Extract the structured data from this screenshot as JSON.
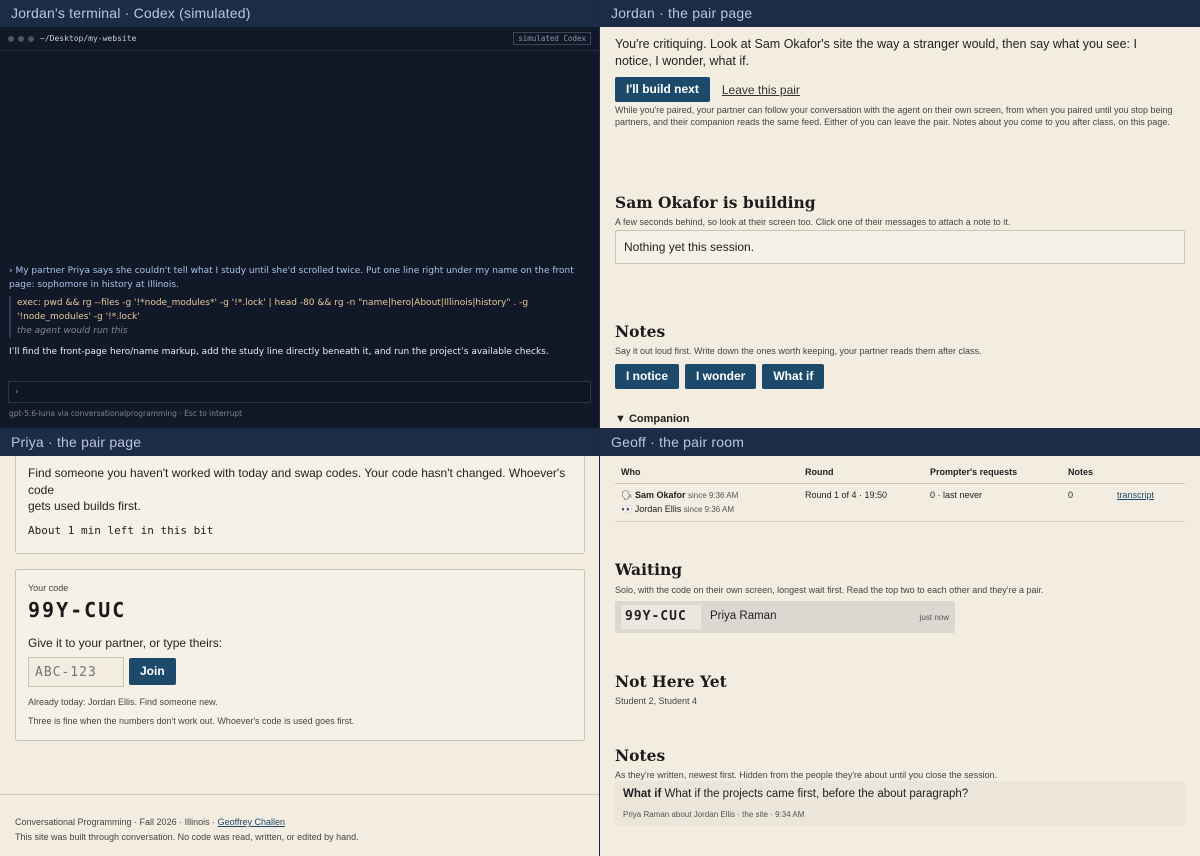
{
  "panes": {
    "tl_title": "Jordan's terminal · Codex (simulated)",
    "tr_title": "Jordan · the pair page",
    "bl_title": "Priya · the pair page",
    "br_title": "Geoff · the pair room"
  },
  "terminal": {
    "path": "~/Desktop/my-website",
    "tag": "simulated Codex",
    "prompt": "› My partner Priya says she couldn't tell what I study until she'd scrolled twice. Put one line right under my name on the front page: sophomore in history at Illinois.",
    "exec": "exec: pwd && rg --files -g '!*node_modules*' -g '!*.lock' | head -80 && rg -n \"name|hero|About|Illinois|history\" . -g '!node_modules' -g '!*.lock'",
    "exec_note": "the agent would run this",
    "reply": "I’ll find the front-page hero/name markup, add the study line directly beneath it, and run the project’s available checks.",
    "input_prompt": "›",
    "status": "gpt-5.6-luna via conversationalprogramming  ·  Esc to interrupt"
  },
  "jordan_page": {
    "intro": "You're critiquing. Look at Sam Okafor's site the way a stranger would, then say what you see: I notice, I wonder, what if.",
    "build_next": "I'll build next",
    "leave_pair": "Leave this pair",
    "pair_info": "While you're paired, your partner can follow your conversation with the agent on their own screen, from when you paired until you stop being partners, and their companion reads the same feed. Either of you can leave the pair. Notes about you come to you after class, on this page.",
    "building_title": "Sam Okafor is building",
    "building_sub": "A few seconds behind, so look at their screen too. Click one of their messages to attach a note to it.",
    "building_empty": "Nothing yet this session.",
    "notes_title": "Notes",
    "notes_sub": "Say it out loud first. Write down the ones worth keeping, your partner reads them after class.",
    "notice_btn": "I notice",
    "wonder_btn": "I wonder",
    "whatif_btn": "What if",
    "companion": "▼ Companion"
  },
  "priya_page": {
    "swap_text": "Find someone you haven't worked with today and swap codes. Your code hasn't changed. Whoever's code\ngets used builds first.",
    "time_left": "About 1 min left in this bit",
    "your_code_label": "Your code",
    "your_code": "99Y-CUC",
    "give_it": "Give it to your partner, or type theirs:",
    "code_placeholder": "ABC-123",
    "join": "Join",
    "already": "Already today: Jordan Ellis. Find someone new.",
    "three_fine": "Three is fine when the numbers don't work out. Whoever's code is used goes first.",
    "footer_course": "Conversational Programming  ·  Fall 2026  ·  Illinois  · ",
    "footer_author": "Geoffrey Challen",
    "footer_note": "This site was built through conversation. No code was read, written, or edited by hand."
  },
  "geoff_room": {
    "columns": [
      "Who",
      "Round",
      "Prompter's requests",
      "Notes"
    ],
    "row": {
      "who1": "Sam Okafor",
      "who1_since": "since 9:36 AM",
      "who2": "Jordan Ellis",
      "who2_since": "since 9:36 AM",
      "round": "Round 1 of 4 · 19:50",
      "requests": "0 · last never",
      "notes": "0",
      "transcript": "transcript"
    },
    "waiting_title": "Waiting",
    "waiting_sub": "Solo, with the code on their own screen, longest wait first. Read the top two to each other and they're a pair.",
    "waiting_code": "99Y-CUC",
    "waiting_name": "Priya Raman",
    "waiting_time": "just now",
    "nothere_title": "Not Here Yet",
    "nothere_list": "Student 2, Student 4",
    "notes_title": "Notes",
    "notes_sub": "As they're written, newest first. Hidden from the people they're about until you close the session.",
    "note_kind": "What if",
    "note_text": " What if the projects came first, before the about paragraph?",
    "note_meta": "Priya Raman about Jordan Ellis · the site · 9:34 AM"
  }
}
